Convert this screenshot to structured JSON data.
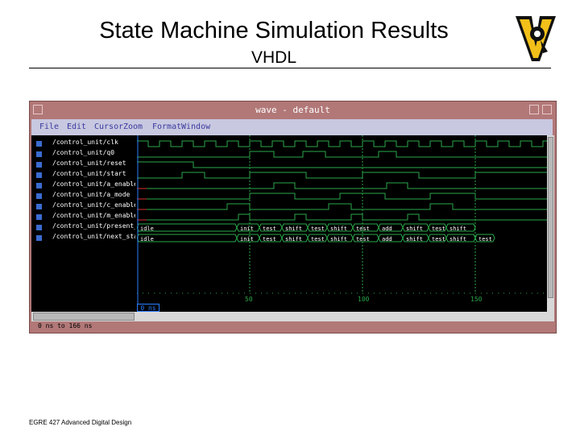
{
  "slide": {
    "title": "State Machine Simulation Results",
    "subtitle": "VHDL",
    "footer": "EGRE 427 Advanced Digital Design"
  },
  "window": {
    "title": "wave - default",
    "menu": [
      "File",
      "Edit",
      "Cursor",
      "Zoom",
      "Format",
      "Window"
    ]
  },
  "signals": [
    {
      "name": "/control_unit/clk",
      "value": "1"
    },
    {
      "name": "/control_unit/q0",
      "value": "0"
    },
    {
      "name": "/control_unit/reset",
      "value": "0"
    },
    {
      "name": "/control_unit/start",
      "value": "0"
    },
    {
      "name": "/control_unit/a_enable",
      "value": "0"
    },
    {
      "name": "/control_unit/a_mode",
      "value": "0"
    },
    {
      "name": "/control_unit/c_enable",
      "value": "0"
    },
    {
      "name": "/control_unit/m_enable",
      "value": "0"
    },
    {
      "name": "/control_unit/present_state",
      "value": "idle"
    },
    {
      "name": "/control_unit/next_state",
      "value": "idle"
    }
  ],
  "bus_labels": {
    "present_state": [
      "idle",
      "init",
      "test",
      "shift",
      "test",
      "shift",
      "test",
      "add",
      "shift",
      "test",
      "shift"
    ],
    "next_state": [
      "idle",
      "init",
      "test",
      "shift",
      "test",
      "shift",
      "test",
      "add",
      "shift",
      "test",
      "shift",
      "test"
    ]
  },
  "time_ticks": [
    "50",
    "100",
    "150"
  ],
  "cursor_value": "0 ns",
  "status_text": "0 ns to 166 ns",
  "colors": {
    "wave": "#2aa84a",
    "highlight": "#d83030",
    "cursor": "#2a7cff"
  }
}
